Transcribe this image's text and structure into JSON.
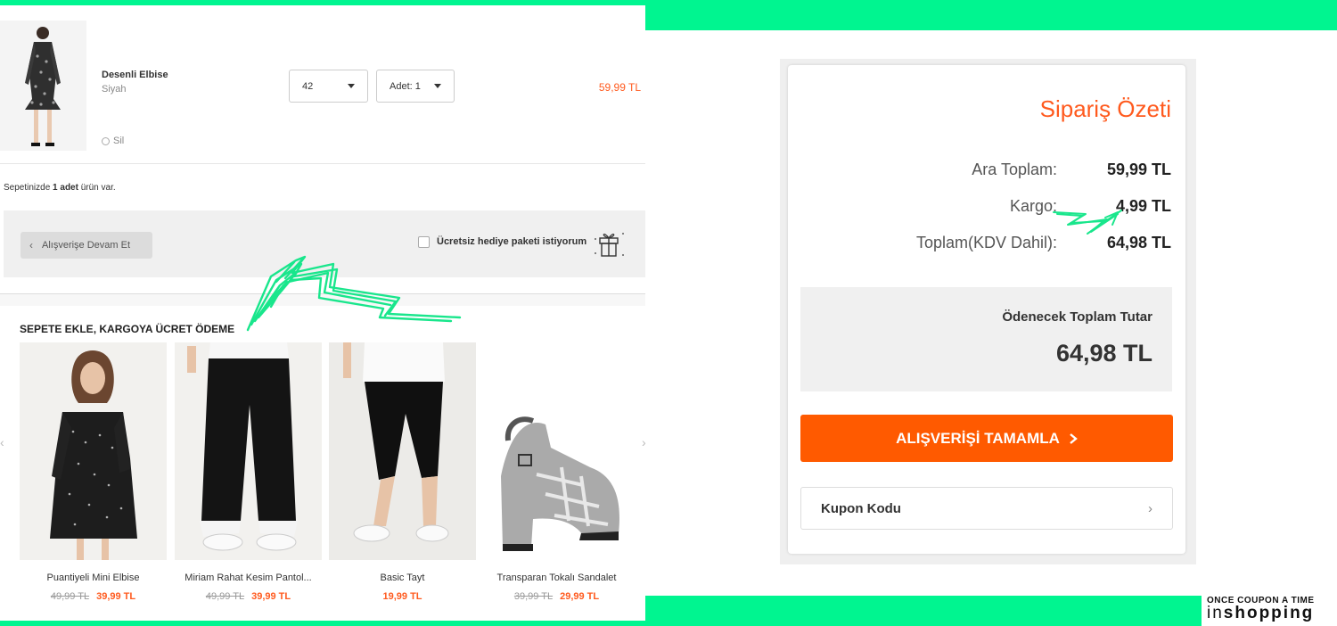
{
  "cart": {
    "item": {
      "name": "Desenli Elbise",
      "color": "Siyah",
      "size": "42",
      "quantity": "Adet: 1",
      "price": "59,99 TL",
      "remove_label": "Sil"
    },
    "count_prefix": "Sepetinizde ",
    "count_value": "1 adet",
    "count_suffix": " ürün var.",
    "continue_label": "Alışverişe Devam Et",
    "gift_label": "Ücretsiz hediye paketi istiyorum"
  },
  "recommendations": {
    "title": "SEPETE EKLE, KARGOYA ÜCRET ÖDEME",
    "items": [
      {
        "name": "Puantiyeli Mini Elbise",
        "old_price": "49,99 TL",
        "price": "39,99 TL"
      },
      {
        "name": "Miriam Rahat Kesim Pantol...",
        "old_price": "49,99 TL",
        "price": "39,99 TL"
      },
      {
        "name": "Basic Tayt",
        "old_price": "",
        "price": "19,99 TL"
      },
      {
        "name": "Transparan Tokalı Sandalet",
        "old_price": "39,99 TL",
        "price": "29,99 TL"
      }
    ]
  },
  "summary": {
    "title": "Sipariş Özeti",
    "subtotal_label": "Ara Toplam:",
    "subtotal_value": "59,99 TL",
    "shipping_label": "Kargo:",
    "shipping_value": "4,99 TL",
    "total_label": "Toplam(KDV Dahil):",
    "total_value": "64,98 TL",
    "payable_label": "Ödenecek Toplam Tutar",
    "payable_value": "64,98 TL",
    "checkout_label": "ALIŞVERİŞİ TAMAMLA",
    "coupon_label": "Kupon Kodu"
  },
  "brand": {
    "tagline": "ONCE COUPON A TIME",
    "name_light": "in",
    "name_bold": "shopping"
  },
  "colors": {
    "accent": "#ff5a1e",
    "frame": "#00f590"
  }
}
